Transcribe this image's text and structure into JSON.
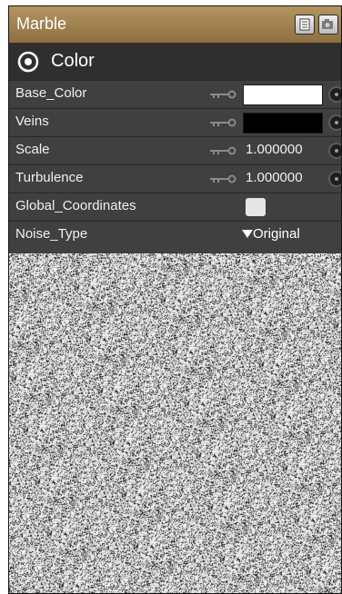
{
  "panel": {
    "title": "Marble",
    "icons": {
      "list": "list-icon",
      "camera": "camera-icon"
    }
  },
  "section": {
    "label": "Color",
    "icon": "target-circle-icon"
  },
  "properties": [
    {
      "name": "Base_Color",
      "control": "color",
      "color": "#ffffff"
    },
    {
      "name": "Veins",
      "control": "color",
      "color": "#000000"
    },
    {
      "name": "Scale",
      "control": "number",
      "value": "1.000000"
    },
    {
      "name": "Turbulence",
      "control": "number",
      "value": "1.000000"
    },
    {
      "name": "Global_Coordinates",
      "control": "checkbox",
      "checked": false
    },
    {
      "name": "Noise_Type",
      "control": "dropdown",
      "value": "Original"
    }
  ],
  "colors": {
    "title_bar": "#a3844f",
    "panel": "#3a3a3a",
    "row": "#404040",
    "text": "#f0f0f0"
  }
}
